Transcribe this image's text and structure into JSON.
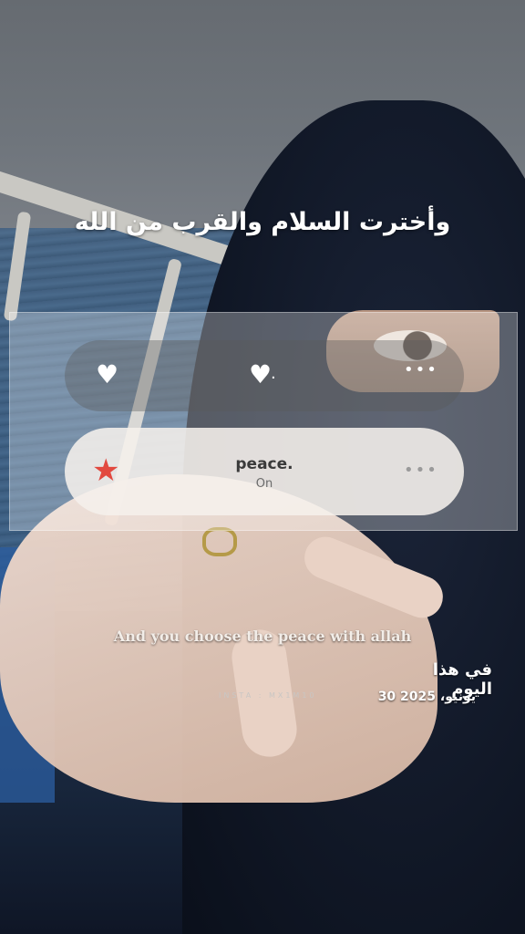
{
  "overlay": {
    "arabic_title": "وأخترت السلام والقرب من الله",
    "caption": "And you choose the peace with allah",
    "watermark": "INSTA : MX1M10",
    "date_heading": "في هذا اليوم",
    "date_text": "30 يونيو، 2025"
  },
  "player": {
    "song_title": "peace.",
    "status": "On",
    "icons": [
      "heart-icon",
      "heart-icon",
      "more-dots-icon",
      "star-icon",
      "more-dots-icon"
    ],
    "star_color": "#e2493f"
  }
}
